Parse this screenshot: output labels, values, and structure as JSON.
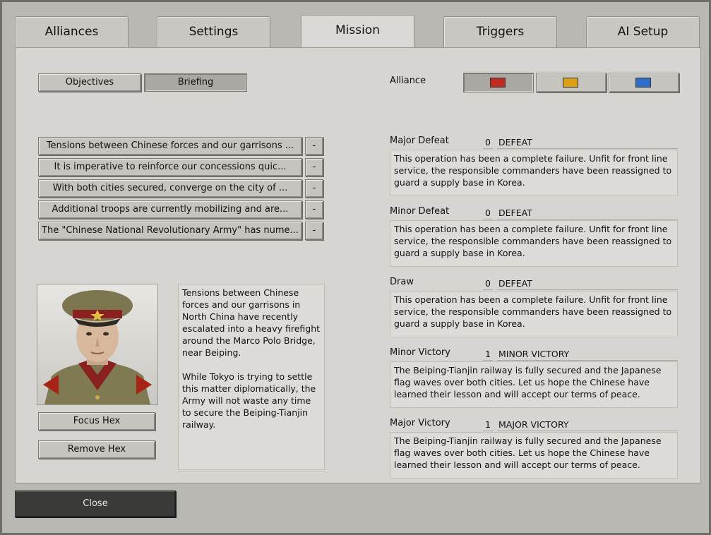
{
  "tabs": [
    "Alliances",
    "Settings",
    "Mission",
    "Triggers",
    "AI Setup"
  ],
  "mode_buttons": {
    "objectives": "Objectives",
    "briefing": "Briefing"
  },
  "alliance": {
    "label": "Alliance",
    "colors": [
      "#c02a20",
      "#dca018",
      "#2e6ec8"
    ]
  },
  "briefing_items": [
    "Tensions between Chinese forces and our garrisons ...",
    "It is imperative to reinforce our concessions quic...",
    "With both cities secured, converge on the city of ...",
    "Additional troops are currently mobilizing and are...",
    "The \"Chinese National Revolutionary Army\" has nume..."
  ],
  "remove_label": "-",
  "briefing_text": "Tensions between Chinese forces and our garrisons in North China have recently escalated into a heavy firefight around the Marco Polo Bridge, near Beiping.\n\nWhile Tokyo is trying to settle this matter diplomatically, the Army will not waste any time to secure the Beiping-Tianjin railway.",
  "portrait_icon": "officer-portrait",
  "focus_hex": "Focus Hex",
  "remove_hex": "Remove Hex",
  "outcomes": [
    {
      "label": "Major Defeat",
      "value": "0",
      "result": "DEFEAT",
      "text": "This operation has been a complete failure. Unfit for front line service, the responsible commanders have been reassigned to guard a supply base in Korea."
    },
    {
      "label": "Minor Defeat",
      "value": "0",
      "result": "DEFEAT",
      "text": "This operation has been a complete failure. Unfit for front line service, the responsible commanders have been reassigned to guard a supply base in Korea."
    },
    {
      "label": "Draw",
      "value": "0",
      "result": "DEFEAT",
      "text": "This operation has been a complete failure. Unfit for front line service, the responsible commanders have been reassigned to guard a supply base in Korea."
    },
    {
      "label": "Minor Victory",
      "value": "1",
      "result": "MINOR VICTORY",
      "text": "The Beiping-Tianjin railway is fully secured and the Japanese flag waves over both cities. Let us hope the Chinese have learned their lesson and will accept our terms of peace."
    },
    {
      "label": "Major Victory",
      "value": "1",
      "result": "MAJOR VICTORY",
      "text": "The Beiping-Tianjin railway is fully secured and the Japanese flag waves over both cities. Let us hope the Chinese have learned their lesson and will accept our terms of peace."
    }
  ],
  "close": "Close"
}
